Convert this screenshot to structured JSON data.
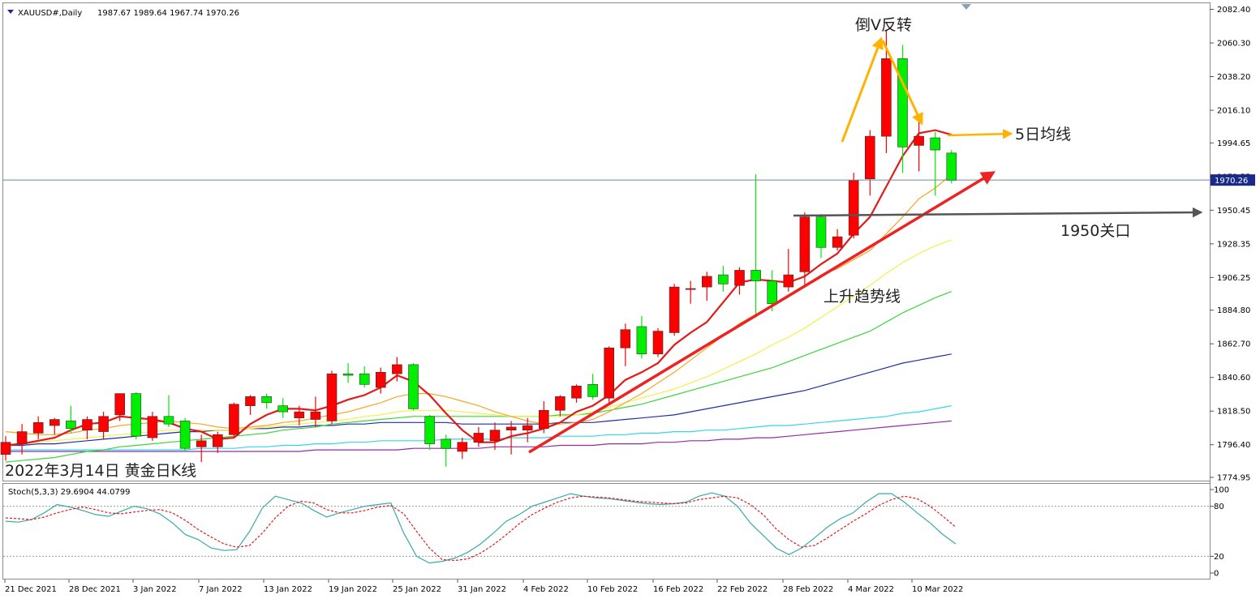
{
  "header": {
    "symbol": "XAUUSD#,Daily",
    "ohlc": "1987.67 1989.64 1967.74 1970.26",
    "subwindow_label": "Stoch(5,3,3) 29.6904 44.0799"
  },
  "annotations": {
    "pattern": "倒V反转",
    "ma5": "5日均线",
    "level": "1950关口",
    "trend": "上升趋势线",
    "caption": "2022年3月14日 黄金日K线"
  },
  "colors": {
    "bull": "#ff0000",
    "bear": "#00ee00",
    "ma5": "#e31a1a",
    "ma10": "#f5a623",
    "ma20": "#f5ef4a",
    "ma30": "#39d639",
    "ma60": "#1f2ea8",
    "ma120": "#33d6e6",
    "ma200": "#8f2ea3",
    "stoch_k": "#3aaaa8",
    "stoch_d": "#e31a1a",
    "arrow_orange": "#ffb300",
    "trendline": "#ee2222",
    "grey_arrow": "#555555"
  },
  "chart_data": {
    "type": "candlestick",
    "price_axis": {
      "ticks": [
        "2082.40",
        "2060.30",
        "2038.20",
        "2016.10",
        "1994.65",
        "1972.55",
        "1950.45",
        "1928.35",
        "1906.25",
        "1884.80",
        "1862.70",
        "1840.60",
        "1818.50",
        "1796.40",
        "1774.95"
      ],
      "range": [
        1770,
        2085
      ],
      "current_price": "1970.26"
    },
    "date_axis": [
      "21 Dec 2021",
      "28 Dec 2021",
      "3 Jan 2022",
      "7 Jan 2022",
      "13 Jan 2022",
      "19 Jan 2022",
      "25 Jan 2022",
      "31 Jan 2022",
      "4 Feb 2022",
      "10 Feb 2022",
      "16 Feb 2022",
      "22 Feb 2022",
      "28 Feb 2022",
      "4 Mar 2022",
      "10 Mar 2022"
    ],
    "candles": [
      {
        "o": 1790,
        "h": 1802,
        "l": 1786,
        "c": 1798
      },
      {
        "o": 1797,
        "h": 1810,
        "l": 1790,
        "c": 1805
      },
      {
        "o": 1804,
        "h": 1815,
        "l": 1800,
        "c": 1811
      },
      {
        "o": 1809,
        "h": 1814,
        "l": 1803,
        "c": 1813
      },
      {
        "o": 1812,
        "h": 1822,
        "l": 1804,
        "c": 1807
      },
      {
        "o": 1806,
        "h": 1815,
        "l": 1800,
        "c": 1813
      },
      {
        "o": 1805,
        "h": 1818,
        "l": 1800,
        "c": 1815
      },
      {
        "o": 1816,
        "h": 1830,
        "l": 1812,
        "c": 1830
      },
      {
        "o": 1830,
        "h": 1831,
        "l": 1800,
        "c": 1802
      },
      {
        "o": 1801,
        "h": 1818,
        "l": 1799,
        "c": 1815
      },
      {
        "o": 1815,
        "h": 1829,
        "l": 1808,
        "c": 1810
      },
      {
        "o": 1812,
        "h": 1814,
        "l": 1792,
        "c": 1794
      },
      {
        "o": 1795,
        "h": 1803,
        "l": 1785,
        "c": 1799
      },
      {
        "o": 1795,
        "h": 1805,
        "l": 1791,
        "c": 1803
      },
      {
        "o": 1803,
        "h": 1824,
        "l": 1801,
        "c": 1823
      },
      {
        "o": 1822,
        "h": 1829,
        "l": 1816,
        "c": 1828
      },
      {
        "o": 1828,
        "h": 1830,
        "l": 1820,
        "c": 1824
      },
      {
        "o": 1822,
        "h": 1827,
        "l": 1814,
        "c": 1818
      },
      {
        "o": 1814,
        "h": 1822,
        "l": 1809,
        "c": 1818
      },
      {
        "o": 1813,
        "h": 1828,
        "l": 1808,
        "c": 1818
      },
      {
        "o": 1812,
        "h": 1845,
        "l": 1810,
        "c": 1843
      },
      {
        "o": 1843,
        "h": 1850,
        "l": 1837,
        "c": 1842
      },
      {
        "o": 1843,
        "h": 1848,
        "l": 1834,
        "c": 1836
      },
      {
        "o": 1834,
        "h": 1847,
        "l": 1830,
        "c": 1844
      },
      {
        "o": 1843,
        "h": 1854,
        "l": 1838,
        "c": 1849
      },
      {
        "o": 1849,
        "h": 1850,
        "l": 1819,
        "c": 1820
      },
      {
        "o": 1815,
        "h": 1816,
        "l": 1793,
        "c": 1797
      },
      {
        "o": 1800,
        "h": 1803,
        "l": 1782,
        "c": 1794
      },
      {
        "o": 1792,
        "h": 1801,
        "l": 1787,
        "c": 1798
      },
      {
        "o": 1798,
        "h": 1808,
        "l": 1795,
        "c": 1804
      },
      {
        "o": 1799,
        "h": 1811,
        "l": 1793,
        "c": 1806
      },
      {
        "o": 1806,
        "h": 1812,
        "l": 1790,
        "c": 1808
      },
      {
        "o": 1806,
        "h": 1814,
        "l": 1798,
        "c": 1809
      },
      {
        "o": 1807,
        "h": 1825,
        "l": 1804,
        "c": 1819
      },
      {
        "o": 1819,
        "h": 1829,
        "l": 1815,
        "c": 1828
      },
      {
        "o": 1827,
        "h": 1836,
        "l": 1824,
        "c": 1835
      },
      {
        "o": 1836,
        "h": 1843,
        "l": 1826,
        "c": 1828
      },
      {
        "o": 1827,
        "h": 1861,
        "l": 1823,
        "c": 1860
      },
      {
        "o": 1860,
        "h": 1876,
        "l": 1848,
        "c": 1872
      },
      {
        "o": 1874,
        "h": 1881,
        "l": 1853,
        "c": 1856
      },
      {
        "o": 1856,
        "h": 1873,
        "l": 1854,
        "c": 1871
      },
      {
        "o": 1870,
        "h": 1902,
        "l": 1868,
        "c": 1900
      },
      {
        "o": 1899,
        "h": 1904,
        "l": 1889,
        "c": 1899
      },
      {
        "o": 1900,
        "h": 1910,
        "l": 1891,
        "c": 1907
      },
      {
        "o": 1908,
        "h": 1914,
        "l": 1897,
        "c": 1902
      },
      {
        "o": 1901,
        "h": 1913,
        "l": 1895,
        "c": 1911
      },
      {
        "o": 1911,
        "h": 1974,
        "l": 1880,
        "c": 1904
      },
      {
        "o": 1904,
        "h": 1911,
        "l": 1884,
        "c": 1889
      },
      {
        "o": 1900,
        "h": 1925,
        "l": 1897,
        "c": 1908
      },
      {
        "o": 1910,
        "h": 1949,
        "l": 1900,
        "c": 1946
      },
      {
        "o": 1946,
        "h": 1948,
        "l": 1919,
        "c": 1926
      },
      {
        "o": 1926,
        "h": 1938,
        "l": 1924,
        "c": 1933
      },
      {
        "o": 1934,
        "h": 1975,
        "l": 1932,
        "c": 1970
      },
      {
        "o": 1971,
        "h": 2003,
        "l": 1960,
        "c": 1999
      },
      {
        "o": 1999,
        "h": 2069,
        "l": 1988,
        "c": 2050
      },
      {
        "o": 2050,
        "h": 2059,
        "l": 1975,
        "c": 1992
      },
      {
        "o": 1993,
        "h": 2009,
        "l": 1976,
        "c": 1999
      },
      {
        "o": 1998,
        "h": 2002,
        "l": 1960,
        "c": 1990
      },
      {
        "o": 1988,
        "h": 1990,
        "l": 1968,
        "c": 1970
      }
    ],
    "ma5": [
      1796,
      1797,
      1799,
      1801,
      1806,
      1810,
      1811,
      1815,
      1814,
      1813,
      1811,
      1807,
      1805,
      1800,
      1801,
      1810,
      1816,
      1820,
      1820,
      1819,
      1822,
      1826,
      1829,
      1834,
      1842,
      1838,
      1829,
      1817,
      1806,
      1798,
      1798,
      1802,
      1804,
      1807,
      1811,
      1818,
      1822,
      1829,
      1839,
      1844,
      1850,
      1862,
      1870,
      1877,
      1890,
      1903,
      1905,
      1904,
      1903,
      1907,
      1915,
      1922,
      1935,
      1946,
      1966,
      1986,
      2001,
      2003,
      2000
    ],
    "ma10": [
      1805,
      1804,
      1803,
      1803,
      1804,
      1806,
      1807,
      1809,
      1810,
      1811,
      1812,
      1811,
      1810,
      1808,
      1807,
      1808,
      1809,
      1811,
      1812,
      1814,
      1816,
      1818,
      1821,
      1824,
      1828,
      1830,
      1830,
      1828,
      1825,
      1822,
      1818,
      1815,
      1812,
      1810,
      1810,
      1811,
      1813,
      1818,
      1824,
      1830,
      1837,
      1844,
      1852,
      1860,
      1868,
      1876,
      1882,
      1888,
      1894,
      1900,
      1908,
      1912,
      1918,
      1924,
      1935,
      1946,
      1958,
      1965,
      1974
    ],
    "ma20": [
      1797,
      1797,
      1798,
      1799,
      1800,
      1801,
      1802,
      1803,
      1804,
      1805,
      1806,
      1806,
      1806,
      1806,
      1806,
      1807,
      1808,
      1809,
      1810,
      1811,
      1812,
      1813,
      1815,
      1816,
      1818,
      1819,
      1819,
      1819,
      1818,
      1817,
      1816,
      1815,
      1815,
      1815,
      1815,
      1816,
      1818,
      1821,
      1824,
      1827,
      1830,
      1833,
      1837,
      1841,
      1846,
      1851,
      1856,
      1862,
      1867,
      1873,
      1880,
      1887,
      1894,
      1901,
      1909,
      1916,
      1922,
      1927,
      1931
    ],
    "ma30": [
      1785,
      1786,
      1787,
      1788,
      1790,
      1792,
      1793,
      1795,
      1796,
      1797,
      1798,
      1799,
      1800,
      1801,
      1802,
      1803,
      1804,
      1806,
      1807,
      1808,
      1810,
      1811,
      1812,
      1813,
      1814,
      1815,
      1815,
      1815,
      1815,
      1815,
      1815,
      1815,
      1815,
      1815,
      1816,
      1816,
      1817,
      1819,
      1821,
      1823,
      1826,
      1829,
      1832,
      1835,
      1838,
      1841,
      1844,
      1847,
      1851,
      1855,
      1859,
      1863,
      1867,
      1871,
      1877,
      1883,
      1888,
      1893,
      1897
    ],
    "ma60": [
      1796,
      1796,
      1797,
      1797,
      1798,
      1799,
      1800,
      1801,
      1802,
      1803,
      1804,
      1805,
      1805,
      1806,
      1806,
      1807,
      1807,
      1808,
      1808,
      1809,
      1809,
      1810,
      1810,
      1811,
      1811,
      1811,
      1811,
      1811,
      1810,
      1810,
      1810,
      1810,
      1810,
      1810,
      1811,
      1811,
      1811,
      1812,
      1813,
      1814,
      1815,
      1816,
      1818,
      1820,
      1822,
      1824,
      1826,
      1828,
      1830,
      1832,
      1835,
      1838,
      1841,
      1844,
      1847,
      1850,
      1852,
      1854,
      1856
    ],
    "ma120": [
      1793,
      1793,
      1793,
      1793,
      1793,
      1793,
      1793,
      1793,
      1793,
      1793,
      1793,
      1793,
      1794,
      1794,
      1794,
      1795,
      1795,
      1796,
      1796,
      1797,
      1797,
      1798,
      1798,
      1799,
      1799,
      1799,
      1799,
      1800,
      1800,
      1800,
      1800,
      1801,
      1801,
      1801,
      1802,
      1802,
      1802,
      1803,
      1803,
      1804,
      1804,
      1805,
      1805,
      1806,
      1806,
      1807,
      1808,
      1809,
      1809,
      1810,
      1811,
      1812,
      1813,
      1814,
      1815,
      1817,
      1818,
      1820,
      1822
    ],
    "ma200": [
      1792,
      1792,
      1792,
      1792,
      1792,
      1792,
      1792,
      1792,
      1792,
      1792,
      1792,
      1792,
      1792,
      1792,
      1792,
      1792,
      1792,
      1792,
      1792,
      1793,
      1793,
      1793,
      1793,
      1793,
      1793,
      1794,
      1794,
      1794,
      1794,
      1794,
      1795,
      1795,
      1795,
      1795,
      1796,
      1796,
      1796,
      1797,
      1797,
      1797,
      1798,
      1798,
      1799,
      1799,
      1800,
      1800,
      1801,
      1801,
      1802,
      1803,
      1804,
      1805,
      1806,
      1807,
      1808,
      1809,
      1810,
      1811,
      1812
    ],
    "stoch": {
      "ticks": [
        "100",
        "80",
        "20",
        "0"
      ],
      "levels": [
        80,
        20
      ],
      "k": [
        62,
        61,
        64,
        72,
        82,
        79,
        75,
        70,
        68,
        74,
        80,
        77,
        71,
        60,
        46,
        40,
        30,
        27,
        28,
        50,
        78,
        92,
        88,
        84,
        75,
        67,
        72,
        76,
        80,
        82,
        84,
        48,
        20,
        12,
        14,
        18,
        25,
        35,
        48,
        62,
        70,
        80,
        85,
        90,
        95,
        92,
        90,
        89,
        87,
        85,
        83,
        82,
        83,
        85,
        92,
        96,
        92,
        80,
        60,
        45,
        30,
        22,
        30,
        42,
        55,
        65,
        72,
        85,
        95,
        95,
        85,
        72,
        60,
        46,
        35
      ],
      "d": [
        66,
        65,
        64,
        67,
        72,
        76,
        79,
        76,
        72,
        71,
        73,
        75,
        76,
        72,
        63,
        52,
        43,
        35,
        31,
        33,
        48,
        66,
        80,
        86,
        84,
        76,
        72,
        72,
        75,
        79,
        81,
        71,
        50,
        30,
        16,
        15,
        17,
        24,
        34,
        46,
        59,
        70,
        78,
        85,
        90,
        92,
        91,
        90,
        88,
        86,
        85,
        84,
        83,
        84,
        88,
        90,
        92,
        90,
        82,
        70,
        53,
        40,
        31,
        33,
        42,
        52,
        62,
        71,
        81,
        88,
        92,
        89,
        80,
        68,
        55
      ]
    }
  }
}
